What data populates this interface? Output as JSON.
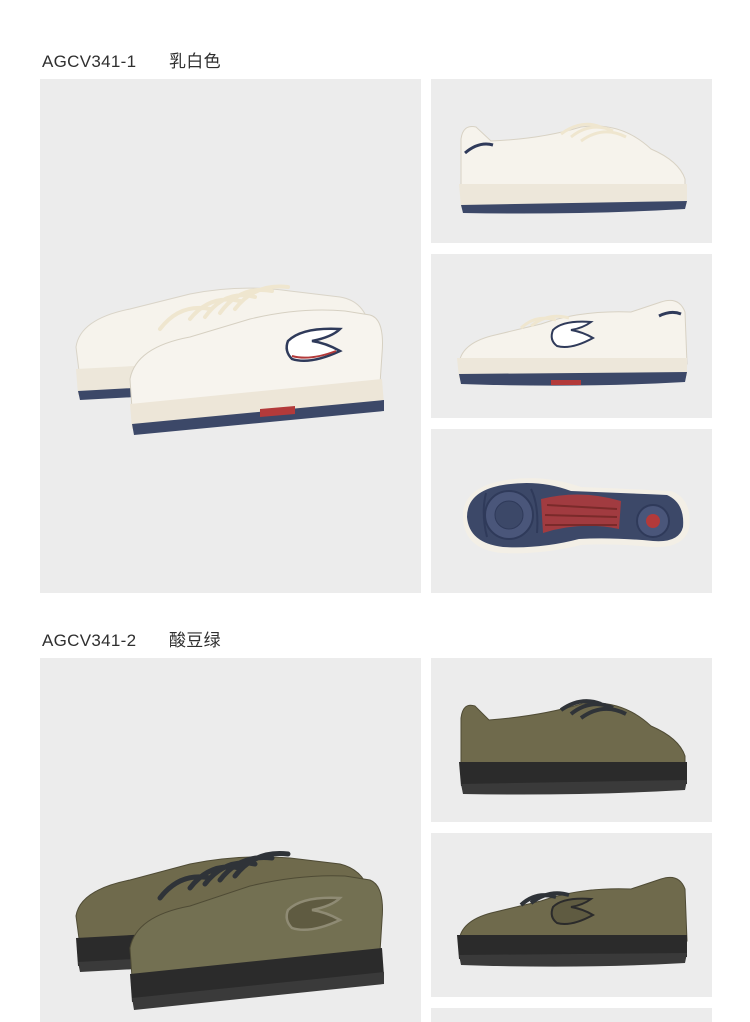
{
  "variants": [
    {
      "code": "AGCV341-1",
      "color_name": "乳白色",
      "colors": {
        "upper": "#f4f1ea",
        "upper_shade": "#e4dfd4",
        "sole": "#ece6d8",
        "outsole": "#3c4868",
        "accent": "#b33a3a",
        "laces": "#efe6cf",
        "logo_outline": "#2f3a5a"
      }
    },
    {
      "code": "AGCV341-2",
      "color_name": "酸豆绿",
      "colors": {
        "upper": "#6f6a4c",
        "upper_shade": "#5a563d",
        "sole": "#2b2b2b",
        "outsole": "#3a3a3a",
        "accent": "#6a6a6a",
        "laces": "#2f3338",
        "logo_outline": "#2b2b2b"
      }
    }
  ],
  "images": {
    "variant1": [
      "hero-pair",
      "side-view",
      "side-view-logo",
      "outsole-view"
    ],
    "variant2": [
      "hero-pair",
      "side-view",
      "side-view-logo",
      "partial"
    ]
  }
}
